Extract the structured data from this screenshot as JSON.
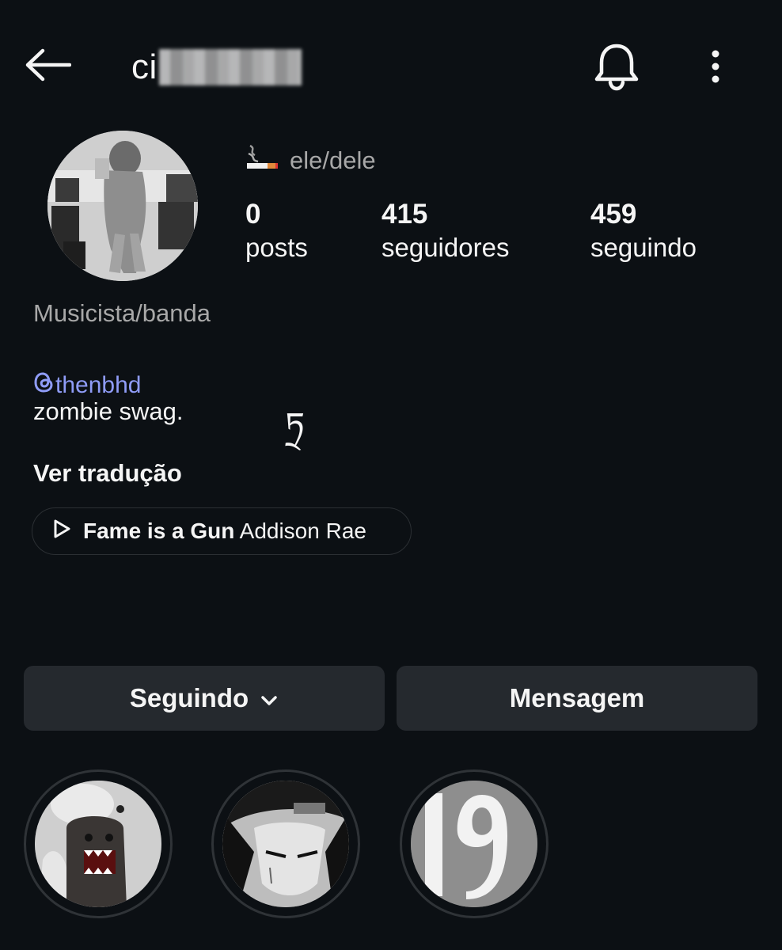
{
  "header": {
    "username_visible": "ci",
    "back_icon": "arrow-left-icon",
    "bell_icon": "bell-icon",
    "more_icon": "more-vertical-icon"
  },
  "profile": {
    "avatar_icon": "profile-avatar",
    "pronouns_emoji": "🚬",
    "pronouns": "ele/dele",
    "stats": [
      {
        "value": "0",
        "label": "posts"
      },
      {
        "value": "415",
        "label": "seguidores"
      },
      {
        "value": "459",
        "label": "seguindo"
      }
    ],
    "category": "Musicista/banda",
    "threads_handle": "thenbhd",
    "bio": "zombie swag.",
    "bio_glyph": "ཏྲ",
    "translate_label": "Ver tradução",
    "music": {
      "song": "Fame is a Gun",
      "artist": "Addison Rae"
    }
  },
  "actions": {
    "following_label": "Seguindo",
    "message_label": "Mensagem"
  },
  "highlights": [
    "domo-highlight",
    "itachi-highlight",
    "number-19-highlight"
  ],
  "colors": {
    "background": "#0c1014",
    "button": "#25292e",
    "link": "#8f9cf7",
    "muted": "#a8a8a8"
  }
}
